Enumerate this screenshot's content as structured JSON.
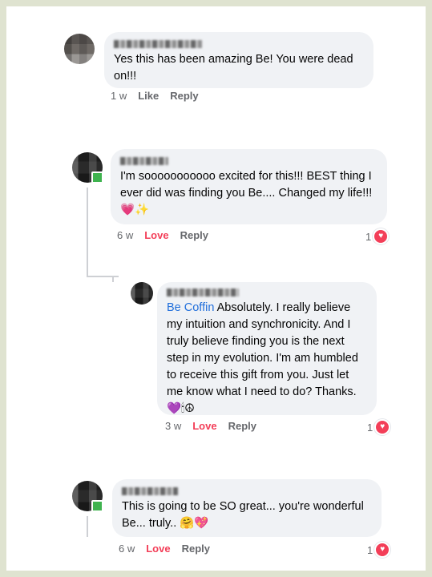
{
  "comments": [
    {
      "text": "Yes this has been amazing Be! You were dead on!!!",
      "time": "1 w",
      "like_label": "Like",
      "reply_label": "Reply"
    },
    {
      "text": "I'm sooooooooooo excited for this!!! BEST thing I ever did was finding you Be.... Changed my life!!!",
      "emoji": "💗✨",
      "time": "6 w",
      "love_label": "Love",
      "reply_label": "Reply",
      "reaction_count": "1"
    },
    {
      "mention": "Be Coffin",
      "text": " Absolutely. I really believe my intuition and synchronicity. And I truly believe finding you is the next step in my evolution. I'm am humbled to receive this gift from you. Just let me know what I need to do? Thanks.",
      "emoji": "💜🕯☮",
      "time": "3 w",
      "love_label": "Love",
      "reply_label": "Reply",
      "reaction_count": "1"
    },
    {
      "text": "This is going to be SO great... you're wonderful Be... truly..",
      "emoji": "🤗💖",
      "time": "6 w",
      "love_label": "Love",
      "reply_label": "Reply",
      "reaction_count": "1"
    }
  ],
  "colors": {
    "background": "#dfe3d0",
    "bubble": "#f0f2f5",
    "love": "#f33e58",
    "mention": "#216fdb"
  }
}
